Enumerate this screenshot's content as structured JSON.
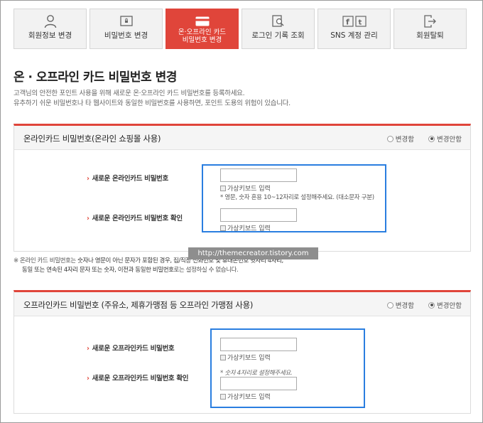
{
  "tabs": [
    {
      "label": "회원정보 변경",
      "icon": "person-icon"
    },
    {
      "label": "비밀번호 변경",
      "icon": "lock-screen-icon"
    },
    {
      "label": "온·오프라인 카드\n비밀번호 변경",
      "icon": "card-icon",
      "active": true
    },
    {
      "label": "로그인 기록 조회",
      "icon": "search-document-icon"
    },
    {
      "label": "SNS 계정 관리",
      "icon": "sns-icon"
    },
    {
      "label": "회원탈퇴",
      "icon": "exit-icon"
    }
  ],
  "page": {
    "title": "온 · 오프라인 카드 비밀번호 변경",
    "desc1": "고객님의 안전한 포인트 사용을 위해 새로운 온·오프라인 카드 비밀번호를 등록하세요.",
    "desc2": "유추하기 쉬운 비밀번호나 타 웹사이트와 동일한 비밀번호를 사용하면, 포인트 도용의 위험이 있습니다."
  },
  "online": {
    "title": "온라인카드 비밀번호(온라인 쇼핑몰 사용)",
    "radio_change": "변경함",
    "radio_keep": "변경안함",
    "new_label": "새로운 온라인카드 비밀번호",
    "confirm_label": "새로운 온라인카드 비밀번호 확인",
    "vk_label": "가상키보드 입력",
    "hint": "* 영문, 숫자 혼용 10~12자리로 설정해주세요. (대소문자 구분)"
  },
  "notice": {
    "mark": "※",
    "line1_a": "온라인 카드 비밀번호는 ",
    "line1_b": "숫자나 영문이 아닌 문자가 포함된 경우, 집/직장 전화번호 및 휴대폰번호 뒷자리 4자리,",
    "line2_a": "동일 또는 연속된 4자리 문자 또는 숫자, 이전과 동일한 비밀번호",
    "line2_b": "로는 설정하실 수 없습니다."
  },
  "watermark": "http://themecreator.tistory.com",
  "offline": {
    "title": "오프라인카드 비밀번호 (주유소, 제휴가맹점 등 오프라인 가맹점 사용)",
    "radio_change": "변경함",
    "radio_keep": "변경안함",
    "new_label": "새로운 오프라인카드 비밀번호",
    "confirm_label": "새로운 오프라인카드 비밀번호 확인",
    "vk_label": "가상키보드 입력",
    "hint": "* 숫자 4자리로 설정해주세요."
  },
  "colors": {
    "accent": "#e0453a",
    "highlight": "#2a7ee0"
  }
}
